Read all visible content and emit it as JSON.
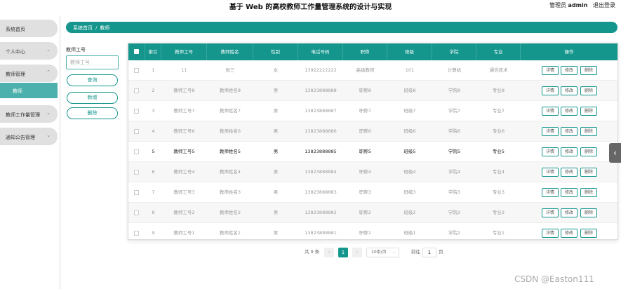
{
  "header": {
    "title": "基于 Web 的高校教师工作量管理系统的设计与实现",
    "admin_prefix": "管理员",
    "admin_name": "admin",
    "logout": "退出登录"
  },
  "sidebar": {
    "items": [
      {
        "label": "系统首页"
      },
      {
        "label": "个人中心"
      },
      {
        "label": "教师管理"
      },
      {
        "label": "教师工作量管理"
      },
      {
        "label": "通知公告管理"
      }
    ],
    "active_sub": "教师"
  },
  "breadcrumb": {
    "home": "系统首页",
    "separator": "/",
    "current": "教师"
  },
  "search": {
    "label": "教师工号",
    "placeholder": "教师工号",
    "query_button": "查询",
    "add_button": "新增",
    "delete_button": "删除"
  },
  "table": {
    "columns": [
      "索引",
      "教师工号",
      "教师姓名",
      "性别",
      "电话号码",
      "职称",
      "班级",
      "学院",
      "专业",
      "操作"
    ],
    "actions": {
      "detail": "详情",
      "edit": "修改",
      "delete": "删除"
    },
    "rows": [
      {
        "index": "1",
        "id": "11",
        "name": "张三",
        "gender": "女",
        "phone": "13922222222",
        "title": "高级教师",
        "class": "101",
        "college": "计算机",
        "major": "通信技术"
      },
      {
        "index": "2",
        "id": "教师工号8",
        "name": "教师姓名8",
        "gender": "男",
        "phone": "13823888888",
        "title": "职称8",
        "class": "班级8",
        "college": "学院8",
        "major": "专业8"
      },
      {
        "index": "3",
        "id": "教师工号7",
        "name": "教师姓名7",
        "gender": "男",
        "phone": "13823888887",
        "title": "职称7",
        "class": "班级7",
        "college": "学院7",
        "major": "专业7"
      },
      {
        "index": "4",
        "id": "教师工号6",
        "name": "教师姓名6",
        "gender": "男",
        "phone": "13823888886",
        "title": "职称6",
        "class": "班级6",
        "college": "学院6",
        "major": "专业6"
      },
      {
        "index": "5",
        "id": "教师工号5",
        "name": "教师姓名5",
        "gender": "男",
        "phone": "13823888885",
        "title": "职称5",
        "class": "班级5",
        "college": "学院5",
        "major": "专业5"
      },
      {
        "index": "6",
        "id": "教师工号4",
        "name": "教师姓名4",
        "gender": "男",
        "phone": "13823888884",
        "title": "职称4",
        "class": "班级4",
        "college": "学院4",
        "major": "专业4"
      },
      {
        "index": "7",
        "id": "教师工号3",
        "name": "教师姓名3",
        "gender": "男",
        "phone": "13823888883",
        "title": "职称3",
        "class": "班级3",
        "college": "学院3",
        "major": "专业3"
      },
      {
        "index": "8",
        "id": "教师工号2",
        "name": "教师姓名2",
        "gender": "男",
        "phone": "13823888882",
        "title": "职称2",
        "class": "班级2",
        "college": "学院2",
        "major": "专业2"
      },
      {
        "index": "9",
        "id": "教师工号1",
        "name": "教师姓名1",
        "gender": "男",
        "phone": "13823888881",
        "title": "职称1",
        "class": "班级1",
        "college": "学院1",
        "major": "专业1"
      }
    ]
  },
  "pagination": {
    "total": "共 9 条",
    "prev": "‹",
    "page": "1",
    "next": "›",
    "page_size": "10条/页",
    "goto_label": "前往",
    "goto_value": "1",
    "page_unit": "页"
  },
  "watermark": "CSDN @Easton111",
  "colors": {
    "accent": "#14968d",
    "sidebar_active": "#4cb1ac"
  }
}
